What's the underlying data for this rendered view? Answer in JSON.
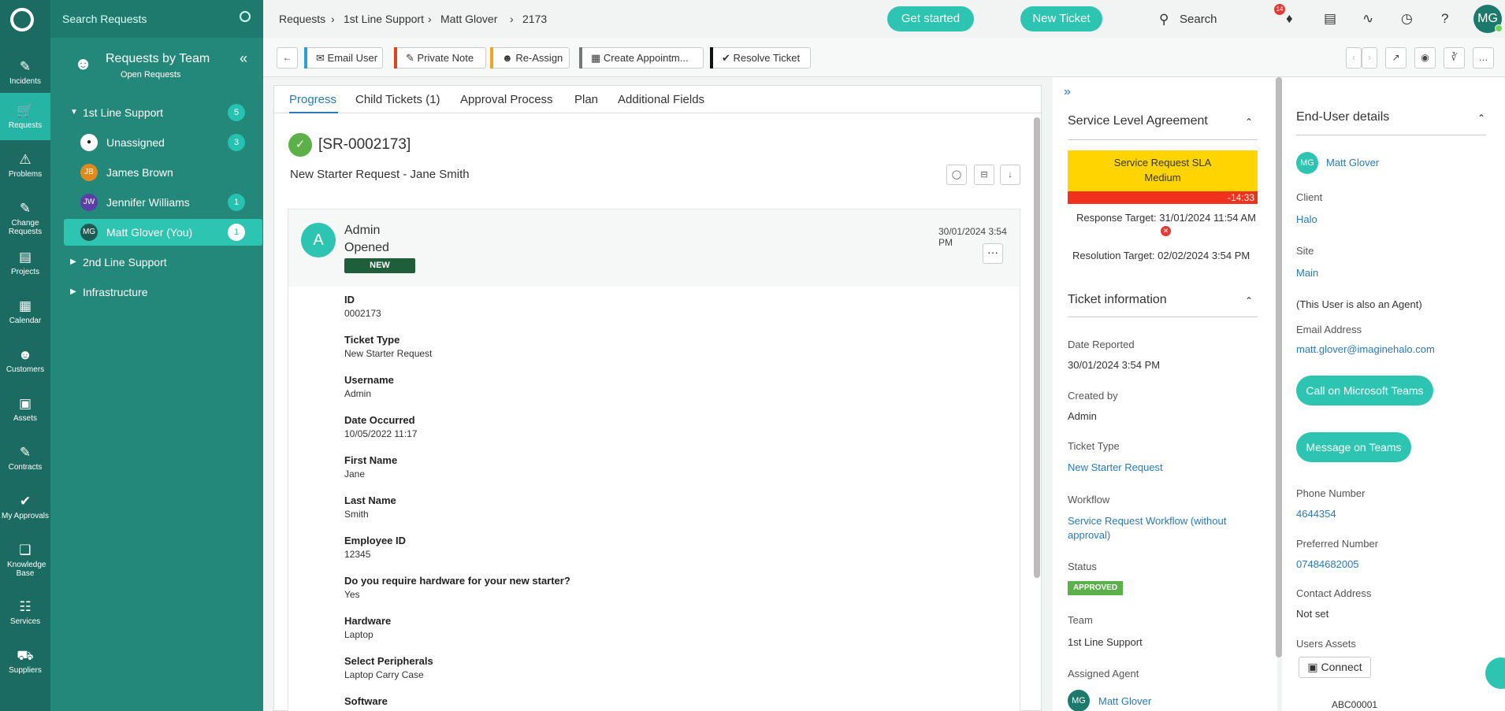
{
  "rail": {
    "items": [
      {
        "label": "Incidents",
        "icon": "ticket-icon"
      },
      {
        "label": "Requests",
        "icon": "cart-icon"
      },
      {
        "label": "Problems",
        "icon": "warning-icon"
      },
      {
        "label": "Change Requests",
        "icon": "edit-icon"
      },
      {
        "label": "Projects",
        "icon": "projects-icon"
      },
      {
        "label": "Calendar",
        "icon": "calendar-icon"
      },
      {
        "label": "Customers",
        "icon": "user-icon"
      },
      {
        "label": "Assets",
        "icon": "laptop-icon"
      },
      {
        "label": "Contracts",
        "icon": "contract-icon"
      },
      {
        "label": "My Approvals",
        "icon": "thumbs-up-icon"
      },
      {
        "label": "Knowledge Base",
        "icon": "cubes-icon"
      },
      {
        "label": "Services",
        "icon": "book-icon"
      },
      {
        "label": "Suppliers",
        "icon": "truck-icon"
      }
    ]
  },
  "panel": {
    "search_placeholder": "Search Requests",
    "title": "Requests by Team",
    "subtitle": "Open Requests",
    "tree": [
      {
        "label": "1st Line Support",
        "count": "5"
      },
      {
        "initials": "",
        "name": "Unassigned",
        "count": "3",
        "color": "#ffffff"
      },
      {
        "initials": "JB",
        "name": "James Brown",
        "count": "",
        "color": "#e08a1e"
      },
      {
        "initials": "JW",
        "name": "Jennifer Williams",
        "count": "1",
        "color": "#5b3fa6"
      },
      {
        "initials": "MG",
        "name": "Matt Glover (You)",
        "count": "1",
        "color": "#1c5a52"
      },
      {
        "label": "2nd Line Support"
      },
      {
        "label": "Infrastructure"
      }
    ]
  },
  "topbar": {
    "breadcrumb": [
      "Requests",
      "1st Line Support",
      "Matt Glover",
      "2173"
    ],
    "get_started": "Get started",
    "new_ticket": "New Ticket",
    "search": "Search",
    "notif_count": "14",
    "user_initials": "MG"
  },
  "toolbar": {
    "email_user": "Email User",
    "private_note": "Private Note",
    "reassign": "Re-Assign",
    "create_appointment": "Create Appointm...",
    "resolve": "Resolve Ticket"
  },
  "main": {
    "tabs": [
      "Progress",
      "Child Tickets (1)",
      "Approval Process",
      "Plan",
      "Additional Fields"
    ],
    "ticket_id": "[SR-0002173]",
    "summary": "New Starter Request - Jane Smith",
    "action": {
      "avatar": "A",
      "who": "Admin",
      "what": "Opened",
      "badge": "NEW",
      "date": "30/01/2024 3:54 PM"
    },
    "fields": [
      {
        "label": "ID",
        "value": "0002173"
      },
      {
        "label": "Ticket Type",
        "value": "New Starter Request"
      },
      {
        "label": "Username",
        "value": "Admin"
      },
      {
        "label": "Date Occurred",
        "value": "10/05/2022 11:17"
      },
      {
        "label": "First Name",
        "value": "Jane"
      },
      {
        "label": "Last Name",
        "value": "Smith"
      },
      {
        "label": "Employee ID",
        "value": "12345"
      },
      {
        "label": "Do you require hardware for your new starter?",
        "value": "Yes"
      },
      {
        "label": "Hardware",
        "value": "Laptop"
      },
      {
        "label": "Select Peripherals",
        "value": "Laptop Carry Case"
      },
      {
        "label": "Software",
        "value": ""
      }
    ]
  },
  "sla": {
    "title": "Service Level Agreement",
    "sla_name": "Service Request SLA",
    "priority": "Medium",
    "timer": "-14:33",
    "response_target": "Response Target: 31/01/2024 11:54 AM",
    "resolution_target": "Resolution Target: 02/02/2024 3:54 PM",
    "info_title": "Ticket information",
    "date_reported_label": "Date Reported",
    "date_reported": "30/01/2024 3:54 PM",
    "created_by_label": "Created by",
    "created_by": "Admin",
    "ticket_type_label": "Ticket Type",
    "ticket_type": "New Starter Request",
    "workflow_label": "Workflow",
    "workflow": "Service Request Workflow (without approval)",
    "status_label": "Status",
    "status": "APPROVED",
    "team_label": "Team",
    "team": "1st Line Support",
    "agent_label": "Assigned Agent",
    "agent_initials": "MG",
    "agent": "Matt Glover"
  },
  "enduser": {
    "title": "End-User details",
    "initials": "MG",
    "name": "Matt Glover",
    "client_label": "Client",
    "client": "Halo",
    "site_label": "Site",
    "site": "Main",
    "agent_note": "(This User is also an Agent)",
    "email_label": "Email Address",
    "email": "matt.glover@imaginehalo.com",
    "call_teams": "Call on Microsoft Teams",
    "message_teams": "Message on Teams",
    "phone_label": "Phone Number",
    "phone": "4644354",
    "pref_label": "Preferred Number",
    "pref": "07484682005",
    "contact_label": "Contact Address",
    "contact": "Not set",
    "assets_label": "Users Assets",
    "connect": "Connect",
    "asset": "ABC00001"
  }
}
